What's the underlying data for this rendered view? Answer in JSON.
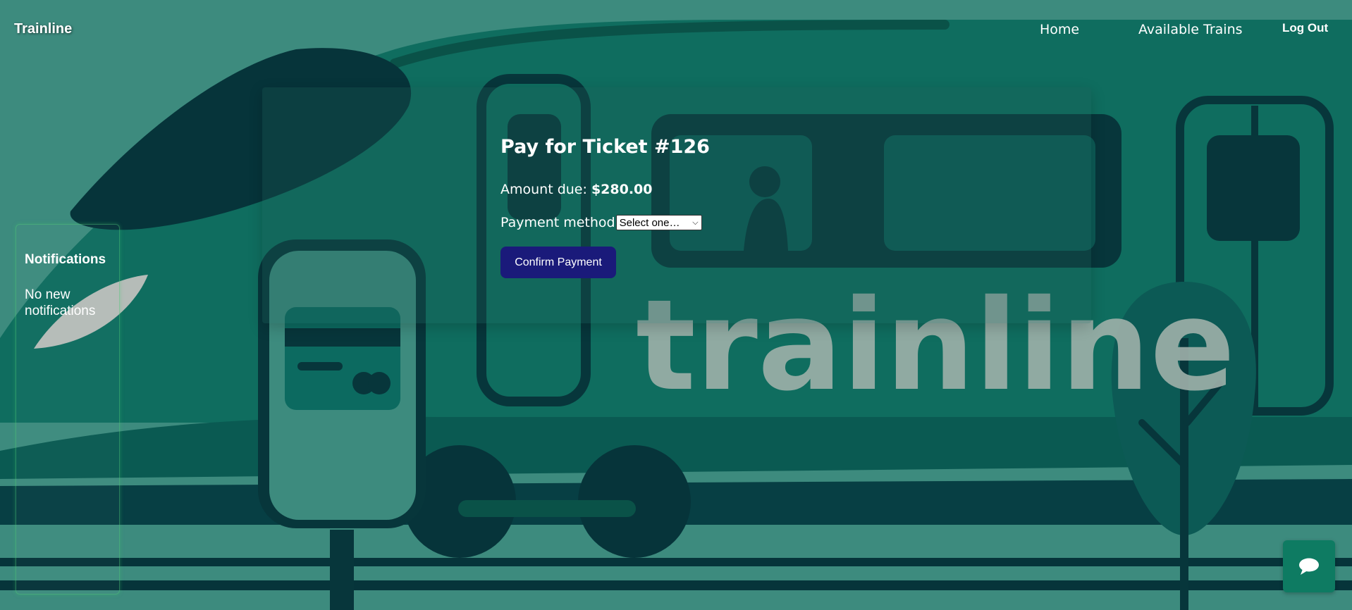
{
  "nav": {
    "brand": "Trainline",
    "home": "Home",
    "trains": "Available Trains",
    "logout": "Log Out"
  },
  "payment": {
    "title": "Pay for Ticket #126",
    "amount_label": "Amount due:",
    "amount_value": "$280.00",
    "method_label": "Payment method",
    "method_selected": "Select one…",
    "confirm_label": "Confirm Payment"
  },
  "notifications": {
    "title": "Notifications",
    "empty_text": "No new notifications"
  },
  "background": {
    "logo_text": "trainline"
  },
  "icons": {
    "chat": "chat-bubble-icon"
  },
  "colors": {
    "background": "#3d8b7e",
    "train_body": "#0f6d5f",
    "dark": "#07363b",
    "confirm_button": "#1a1a7a",
    "chat_button": "#0e7b62"
  }
}
